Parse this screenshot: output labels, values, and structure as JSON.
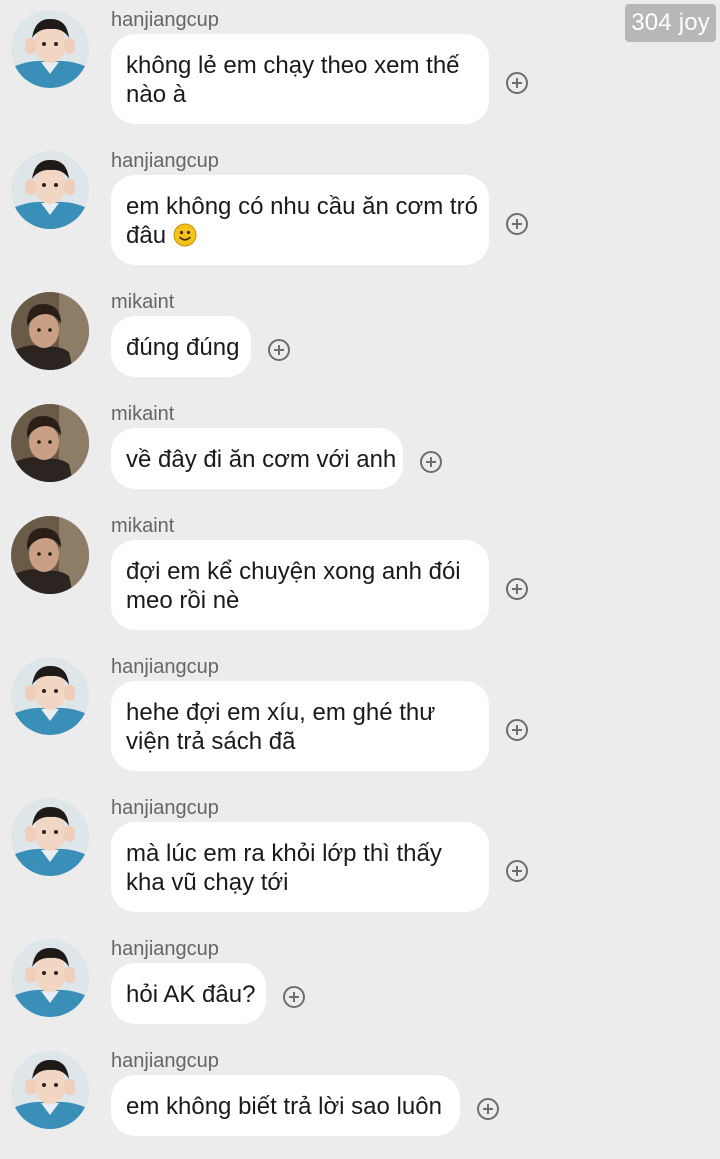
{
  "watermark": "304 joy",
  "colors": {
    "background": "#ececec",
    "bubble": "#ffffff",
    "username": "#666666",
    "text": "#1a1a1a"
  },
  "users": {
    "hanjiangcup": "hanjiangcup",
    "mikaint": "mikaint"
  },
  "messages": [
    {
      "sender": "hanjiangcup",
      "lines": [
        "không lẻ em chạy theo xem thế",
        "nào à"
      ]
    },
    {
      "sender": "hanjiangcup",
      "lines": [
        "em không có nhu cầu ăn cơm tró",
        "đâu"
      ],
      "emoji": "slightly-smiling-face-icon"
    },
    {
      "sender": "mikaint",
      "lines": [
        "đúng đúng"
      ]
    },
    {
      "sender": "mikaint",
      "lines": [
        "về đây đi ăn cơm với anh"
      ]
    },
    {
      "sender": "mikaint",
      "lines": [
        "đợi em kể chuyện xong anh đói",
        "meo rồi nè"
      ]
    },
    {
      "sender": "hanjiangcup",
      "lines": [
        "hehe đợi em xíu, em ghé thư",
        "viện trả sách đã"
      ]
    },
    {
      "sender": "hanjiangcup",
      "lines": [
        "mà lúc em ra khỏi lớp thì thấy",
        "kha vũ chạy tới"
      ]
    },
    {
      "sender": "hanjiangcup",
      "lines": [
        "hỏi AK đâu?"
      ]
    },
    {
      "sender": "hanjiangcup",
      "lines": [
        "em không biết trả lời sao luôn"
      ]
    }
  ]
}
